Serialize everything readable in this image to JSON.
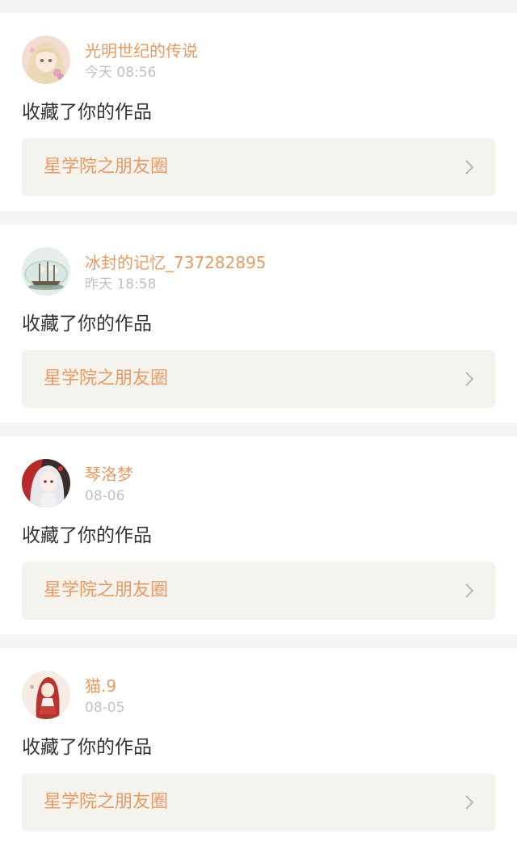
{
  "feed": {
    "items": [
      {
        "username": "光明世纪的传说",
        "time": "今天 08:56",
        "action": "收藏了你的作品",
        "work_title": "星学院之朋友圈",
        "avatar": "anime-girl-blonde-avatar"
      },
      {
        "username": "冰封的记忆_737282895",
        "time": "昨天 18:58",
        "action": "收藏了你的作品",
        "work_title": "星学院之朋友圈",
        "avatar": "ship-in-bottle-avatar"
      },
      {
        "username": "琴洛梦",
        "time": "08-06",
        "action": "收藏了你的作品",
        "work_title": "星学院之朋友圈",
        "avatar": "anime-girl-silver-hair-avatar"
      },
      {
        "username": "猫.9",
        "time": "08-05",
        "action": "收藏了你的作品",
        "work_title": "星学院之朋友圈",
        "avatar": "anime-girl-red-hair-avatar"
      }
    ]
  },
  "colors": {
    "accent": "#e89a62",
    "time_text": "#c2c2c2",
    "body_text": "#333333",
    "link_bg": "#f4f3ed",
    "page_bg": "#f5f4f4",
    "chevron": "#b8b8b8"
  },
  "icons": {
    "chevron": "chevron-right-icon"
  }
}
